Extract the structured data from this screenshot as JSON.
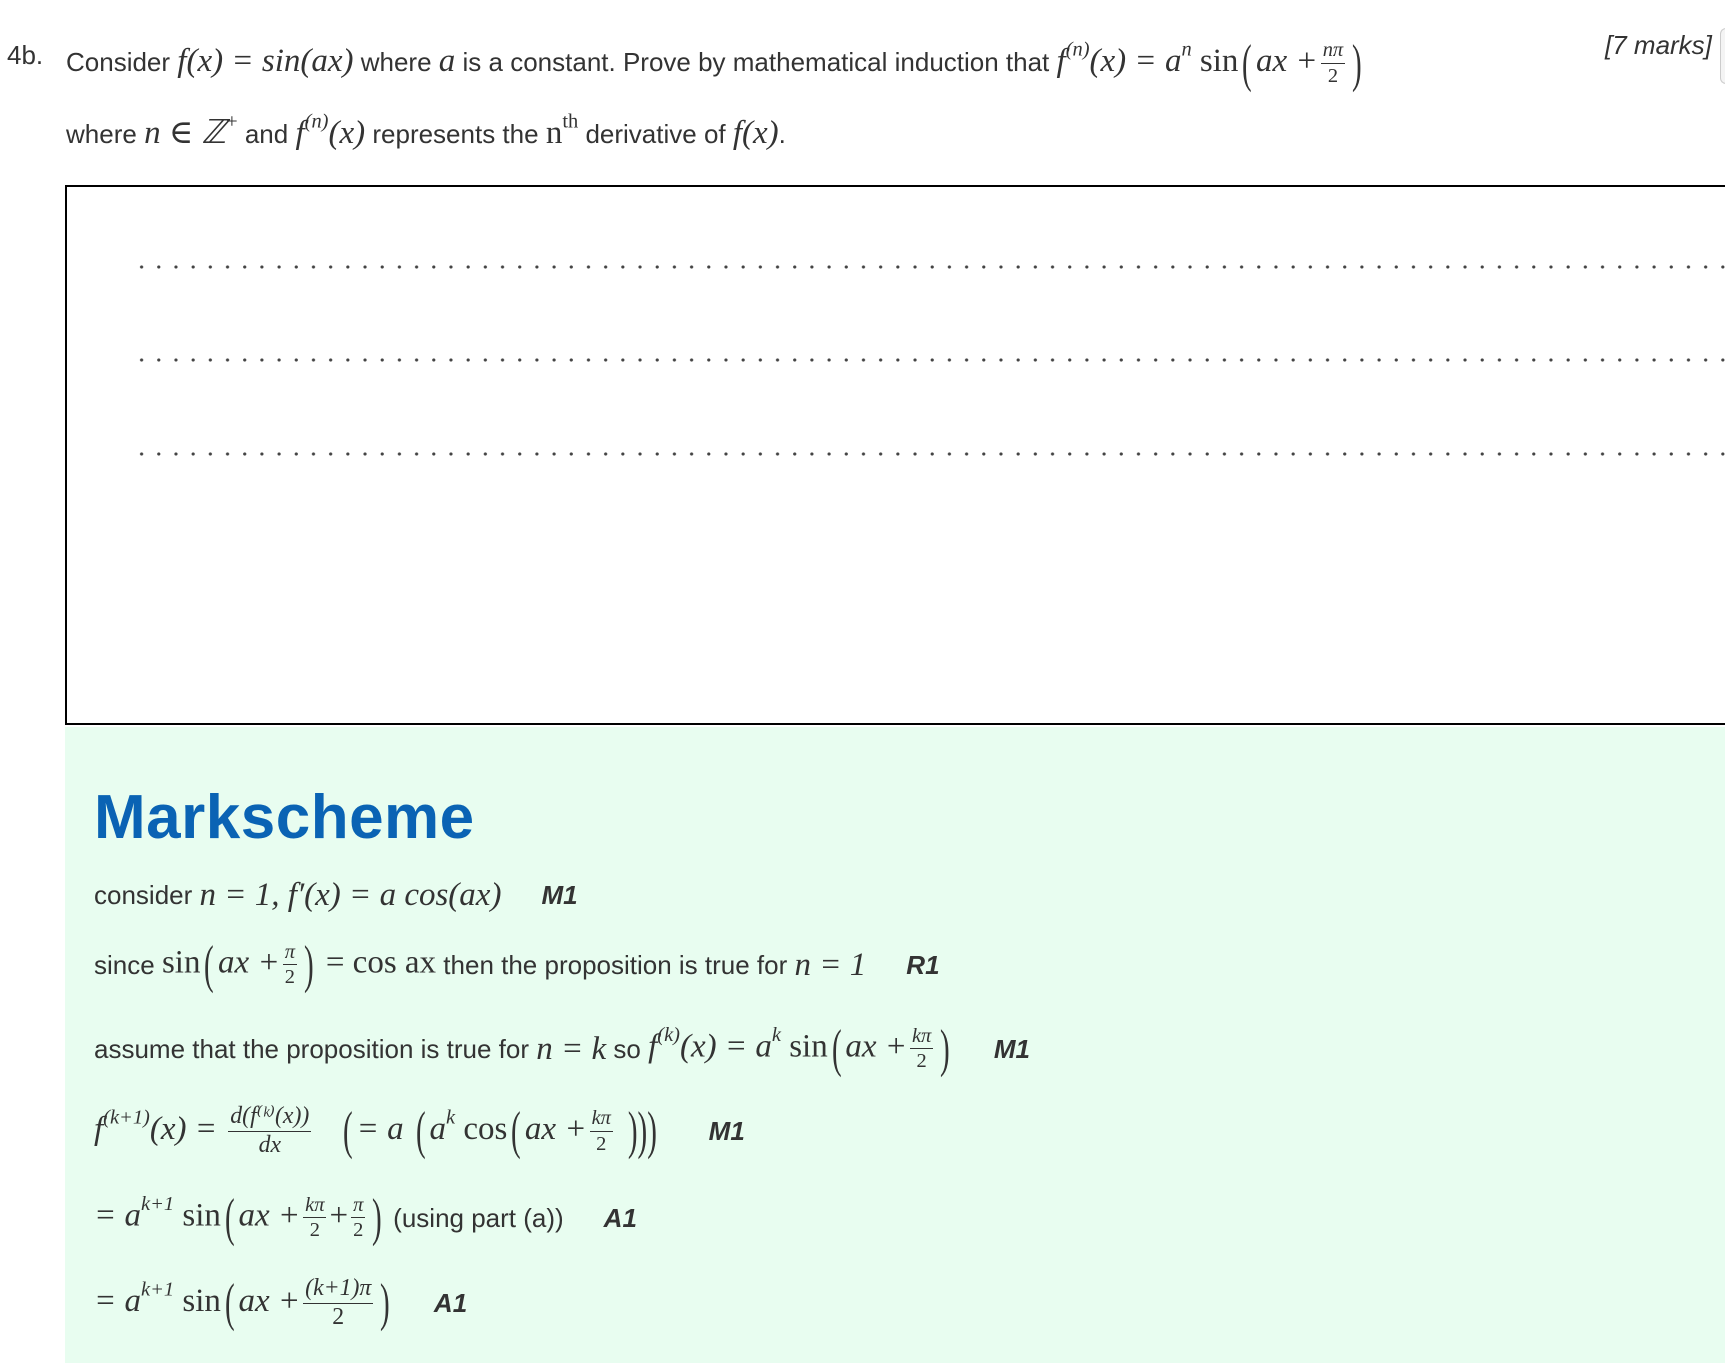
{
  "question": {
    "number": "4b.",
    "marks": "[7 marks]",
    "line1": {
      "t1": "Consider",
      "f_def": "f(x) = sin(ax)",
      "t2": "where",
      "a": "a",
      "t3": "is a constant. Prove by mathematical induction that",
      "claim_lhs": "f",
      "claim_sup": "(n)",
      "claim_mid": "(x) = a",
      "claim_exp": "n",
      "claim_sin": "sin",
      "claim_arg": "ax +",
      "claim_num": "nπ",
      "claim_den": "2"
    },
    "line2": {
      "t1": "where",
      "cond": "n ∈ ℤ",
      "cond_sup": "+",
      "t2": "and",
      "f": "f",
      "f_sup": "(n)",
      "f_arg": "(x)",
      "t3": "represents the",
      "nth": "n",
      "nth_sup": "th",
      "t4": "derivative of",
      "fx": "f(x)",
      "end": "."
    }
  },
  "answer_box": {
    "dotted_lines": 3
  },
  "markscheme": {
    "title": "Markscheme",
    "lines": [
      {
        "text": "consider",
        "math": "n = 1,  f′(x) = a cos(ax)",
        "mark": "M1"
      },
      {
        "text": "since",
        "math_a": "sin",
        "math_b": "ax +",
        "num": "π",
        "den": "2",
        "math_c": "= cos ax",
        "text2": "then the proposition is true for",
        "math_d": "n = 1",
        "mark": "R1"
      },
      {
        "text": "assume that the proposition is true for",
        "math_a": "n = k",
        "text2": "so",
        "f": "f",
        "f_sup": "(k)",
        "math_b": "(x) = a",
        "exp": "k",
        "sin": "sin",
        "arg": "ax +",
        "num": "kπ",
        "den": "2",
        "mark": "M1"
      },
      {
        "f": "f",
        "f_sup": "(k+1)",
        "math_a": "(x) =",
        "d_num": "d(f⁽ᵏ⁾(x))",
        "d_den": "dx",
        "eq": "= a",
        "ak": "a",
        "ak_exp": "k",
        "cos": "cos",
        "arg": "ax +",
        "num": "kπ",
        "den": "2",
        "mark": "M1"
      },
      {
        "eq": "= a",
        "exp": "k+1",
        "sin": "sin",
        "arg": "ax +",
        "num1": "kπ",
        "den1": "2",
        "plus": "+",
        "num2": "π",
        "den2": "2",
        "text": "(using part (a))",
        "mark": "A1"
      },
      {
        "eq": "= a",
        "exp": "k+1",
        "sin": "sin",
        "arg": "ax +",
        "num": "(k+1)π",
        "den": "2",
        "mark": "A1"
      }
    ]
  }
}
